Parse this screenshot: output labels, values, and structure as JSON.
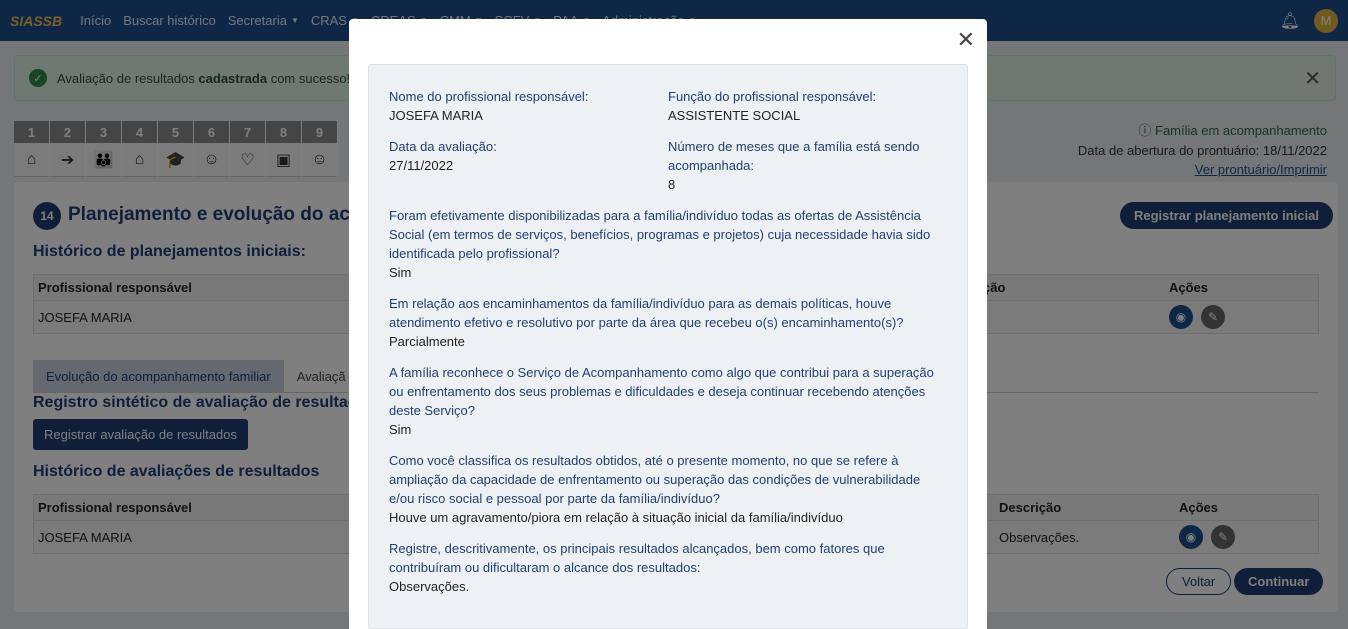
{
  "nav": {
    "brand": "SIASSB",
    "items": [
      {
        "label": "Início",
        "dropdown": false
      },
      {
        "label": "Buscar histórico",
        "dropdown": false
      },
      {
        "label": "Secretaria",
        "dropdown": true
      },
      {
        "label": "CRAS",
        "dropdown": true
      },
      {
        "label": "CREAS",
        "dropdown": true
      },
      {
        "label": "CMM",
        "dropdown": true
      },
      {
        "label": "SCFV",
        "dropdown": true
      },
      {
        "label": "PAA",
        "dropdown": true
      },
      {
        "label": "Administração",
        "dropdown": true
      }
    ],
    "avatar_letter": "M"
  },
  "alert": {
    "prefix": "Avaliação de resultados ",
    "bold": "cadastrada",
    "suffix": " com sucesso!"
  },
  "steps": [
    {
      "num": "1",
      "icon": "⌂"
    },
    {
      "num": "2",
      "icon": "➔"
    },
    {
      "num": "3",
      "icon": "👪"
    },
    {
      "num": "4",
      "icon": "⌂"
    },
    {
      "num": "5",
      "icon": "🎓"
    },
    {
      "num": "6",
      "icon": "☺"
    },
    {
      "num": "7",
      "icon": "♡"
    },
    {
      "num": "8",
      "icon": "▣"
    },
    {
      "num": "9",
      "icon": "☺"
    }
  ],
  "family_status": {
    "status": "Família em acompanhamento",
    "opening_date": "Data de abertura do prontuário: 18/11/2022",
    "link": "Ver prontuário/Imprimir"
  },
  "page": {
    "step_number": "14",
    "title": "Planejamento e evolução do ac",
    "register_plan_button": "Registrar planejamento inicial",
    "hist_plan_title": "Histórico de planejamentos iniciais:",
    "plan_table": {
      "col1": "Profissional responsável",
      "col_mid": "ção",
      "col_actions": "Ações",
      "row_prof": "JOSEFA MARIA"
    },
    "tabs": [
      "Evolução do acompanhamento familiar",
      "Avaliaçã"
    ],
    "sintetico_title": "Registro sintético de avaliação de resultados",
    "register_eval_button": "Registrar avaliação de resultados",
    "hist_eval_title": "Histórico de avaliações de resultados",
    "eval_table": {
      "col1": "Profissional responsável",
      "col_desc": "Descrição",
      "col_actions": "Ações",
      "row_prof": "JOSEFA MARIA",
      "row_desc": "Observações."
    },
    "back_button": "Voltar",
    "continue_button": "Continuar"
  },
  "modal": {
    "fields": {
      "prof_name_label": "Nome do profissional responsável:",
      "prof_name_value": "JOSEFA MARIA",
      "prof_role_label": "Função do profissional responsável:",
      "prof_role_value": "ASSISTENTE SOCIAL",
      "date_label": "Data da avaliação:",
      "date_value": "27/11/2022",
      "months_label": "Número de meses que a família está sendo acompanhada:",
      "months_value": "8"
    },
    "questions": [
      {
        "q": "Foram efetivamente disponibilizadas para a família/indivíduo todas as ofertas de Assistência Social (em termos de serviços, benefícios, programas e projetos) cuja necessidade havia sido identificada pelo profissional?",
        "a": "Sim"
      },
      {
        "q": "Em relação aos encaminhamentos da família/indivíduo para as demais políticas, houve atendimento efetivo e resolutivo por parte da área que recebeu o(s) encaminhamento(s)?",
        "a": "Parcialmente"
      },
      {
        "q": "A família reconhece o Serviço de Acompanhamento como algo que contribui para a superação ou enfrentamento dos seus problemas e dificuldades e deseja continuar recebendo atenções deste Serviço?",
        "a": "Sim"
      },
      {
        "q": "Como você classifica os resultados obtidos, até o presente momento, no que se refere à ampliação da capacidade de enfrentamento ou superação das condições de vulnerabilidade e/ou risco social e pessoal por parte da família/indivíduo?",
        "a": "Houve um agravamento/piora em relação à situação inicial da família/indivíduo"
      },
      {
        "q": "Registre, descritivamente, os principais resultados alcançados, bem como fatores que contribuíram ou dificultaram o alcance dos resultados:",
        "a": "Observações."
      }
    ]
  }
}
